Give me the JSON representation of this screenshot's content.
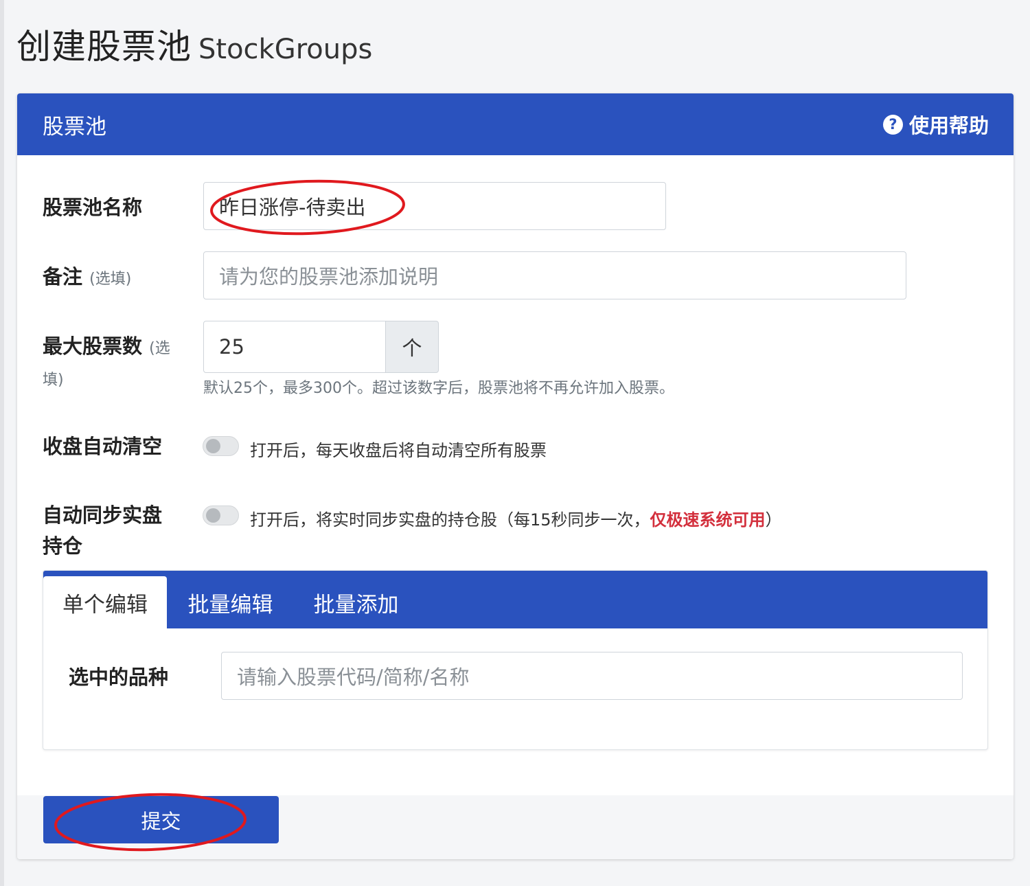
{
  "page": {
    "title": "创建股票池",
    "subtitle": "StockGroups"
  },
  "card": {
    "title": "股票池",
    "help_label": "使用帮助",
    "help_icon": "?"
  },
  "form": {
    "name_label": "股票池名称",
    "name_value": "昨日涨停-待卖出",
    "note_label": "备注",
    "note_optional": "(选填)",
    "note_placeholder": "请为您的股票池添加说明",
    "max_label": "最大股票数",
    "max_optional": "(选",
    "max_optional_2": "填)",
    "max_value": "25",
    "max_unit": "个",
    "max_help": "默认25个，最多300个。超过该数字后，股票池将不再允许加入股票。",
    "auto_clear_label": "收盘自动清空",
    "auto_clear_on": false,
    "auto_clear_text": "打开后，每天收盘后将自动清空所有股票",
    "auto_sync_label": "自动同步实盘持仓",
    "auto_sync_on": false,
    "auto_sync_text_prefix": "打开后，将实时同步实盘的持仓股（每15秒同步一次，",
    "auto_sync_text_warn": "仅极速系统可用",
    "auto_sync_text_suffix": "）"
  },
  "tabs": {
    "items": [
      "单个编辑",
      "批量编辑",
      "批量添加"
    ],
    "active_index": 0,
    "selected_label": "选中的品种",
    "search_placeholder": "请输入股票代码/简称/名称"
  },
  "footer": {
    "submit_label": "提交"
  },
  "colors": {
    "primary": "#2a52be",
    "warning": "#d32f3c",
    "annotation": "#e0191e"
  }
}
